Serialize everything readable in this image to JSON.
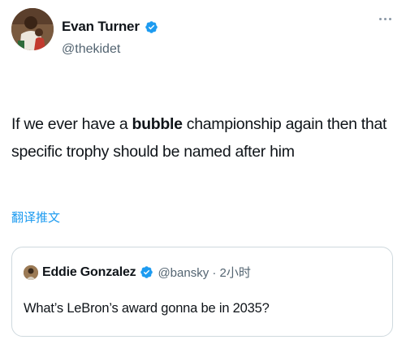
{
  "author": {
    "display_name": "Evan Turner",
    "handle": "@thekidet",
    "verified": true,
    "avatar_icon": "profile-photo"
  },
  "tweet": {
    "text_before": "If we ever have a ",
    "text_bold": "bubble",
    "text_after": " championship again then that specific trophy should be named after him",
    "translate_label": "翻译推文"
  },
  "quoted_tweet": {
    "display_name": "Eddie Gonzalez",
    "handle_time": "@bansky · 2小时",
    "verified": true,
    "text": "What’s LeBron’s award gonna be in 2035?"
  },
  "colors": {
    "accent": "#1d9bf0",
    "text": "#0f1419",
    "secondary": "#536471",
    "border": "#cfd9de"
  }
}
